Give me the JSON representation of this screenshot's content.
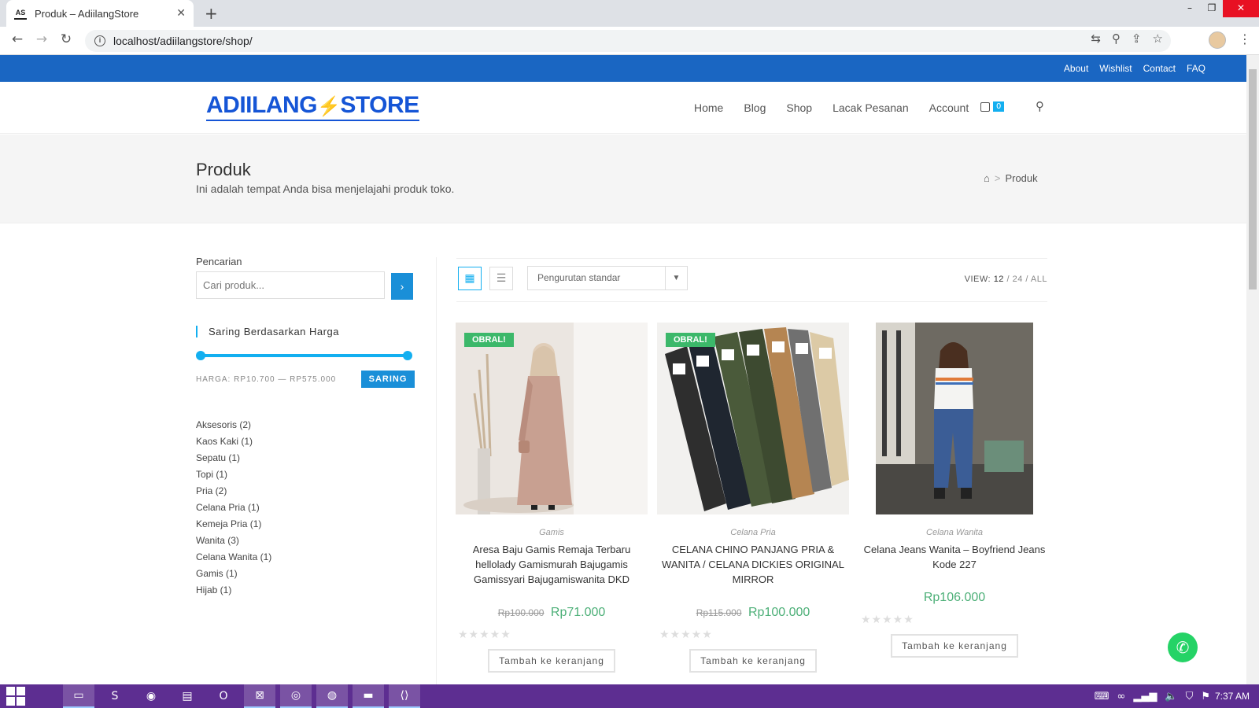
{
  "browser": {
    "tab_title": "Produk – AdiilangStore",
    "tab_favicon": "AS",
    "url": "localhost/adiilangstore/shop/"
  },
  "topbar": {
    "links": [
      "About",
      "Wishlist",
      "Contact",
      "FAQ"
    ]
  },
  "header": {
    "logo_left": "ADIILANG",
    "logo_right": "STORE",
    "nav": [
      "Home",
      "Blog",
      "Shop",
      "Lacak Pesanan",
      "Account"
    ],
    "cart_count": "0"
  },
  "pagehead": {
    "title": "Produk",
    "subtitle": "Ini adalah tempat Anda bisa menjelajahi produk toko.",
    "breadcrumb_current": "Produk"
  },
  "sidebar": {
    "search_label": "Pencarian",
    "search_placeholder": "Cari produk...",
    "price_filter_title": "Saring Berdasarkan Harga",
    "price_range": "HARGA: RP10.700 — RP575.000",
    "filter_button": "SARING",
    "categories": [
      "Aksesoris (2)",
      "Kaos Kaki (1)",
      "Sepatu (1)",
      "Topi (1)",
      "Pria (2)",
      "Celana Pria (1)",
      "Kemeja Pria (1)",
      "Wanita (3)",
      "Celana Wanita (1)",
      "Gamis (1)",
      "Hijab (1)"
    ]
  },
  "toolbar": {
    "sort_selected": "Pengurutan standar",
    "view_label": "VIEW:",
    "view_12": "12",
    "view_24": "24",
    "view_all": "ALL"
  },
  "products": [
    {
      "badge": "OBRAL!",
      "category": "Gamis",
      "name": "Aresa Baju Gamis Remaja Terbaru hellolady Gamismurah Bajugamis Gamissyari Bajugamiswanita DKD",
      "old_price": "Rp100.000",
      "price": "Rp71.000",
      "button": "Tambah ke keranjang"
    },
    {
      "badge": "OBRAL!",
      "category": "Celana Pria",
      "name": "CELANA CHINO PANJANG PRIA & WANITA / CELANA DICKIES ORIGINAL MIRROR",
      "old_price": "Rp115.000",
      "price": "Rp100.000",
      "button": "Tambah ke keranjang"
    },
    {
      "badge": "",
      "category": "Celana Wanita",
      "name": "Celana Jeans Wanita – Boyfriend Jeans Kode 227",
      "old_price": "",
      "price": "Rp106.000",
      "button": "Tambah ke keranjang"
    }
  ],
  "taskbar": {
    "clock": "7:37 AM"
  },
  "colors": {
    "topbar": "#1a66c2",
    "accent": "#13aff0",
    "sale_badge": "#3cb86a",
    "price": "#4caf77",
    "taskbar": "#5d2e91"
  }
}
